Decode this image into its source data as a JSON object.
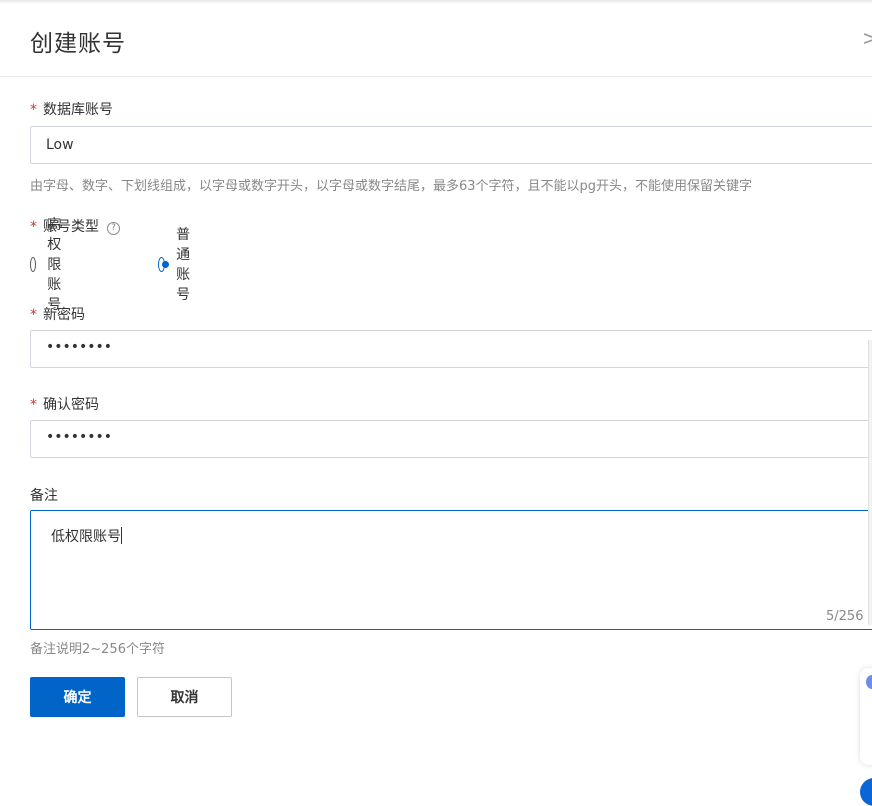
{
  "dialog": {
    "title": "创建账号",
    "close_glyph": ">"
  },
  "form": {
    "db_account": {
      "required_mark": "*",
      "label": "数据库账号",
      "value": "Low",
      "hint": "由字母、数字、下划线组成，以字母或数字开头，以字母或数字结尾，最多63个字符，且不能以pg开头，不能使用保留关键字"
    },
    "account_type": {
      "required_mark": "*",
      "label": "账号类型",
      "help_glyph": "?",
      "options": [
        {
          "label": "高权限账号",
          "checked": false
        },
        {
          "label": "普通账号",
          "checked": true
        }
      ]
    },
    "new_password": {
      "required_mark": "*",
      "label": "新密码",
      "value_masked": "••••••••"
    },
    "confirm_password": {
      "required_mark": "*",
      "label": "确认密码",
      "value_masked": "••••••••"
    },
    "remark": {
      "label": "备注",
      "value": "低权限账号",
      "counter": "5/256",
      "hint": "备注说明2~256个字符"
    }
  },
  "buttons": {
    "confirm": "确定",
    "cancel": "取消"
  },
  "colors": {
    "primary": "#0064c8",
    "required": "#d93026",
    "hint": "#888888"
  }
}
